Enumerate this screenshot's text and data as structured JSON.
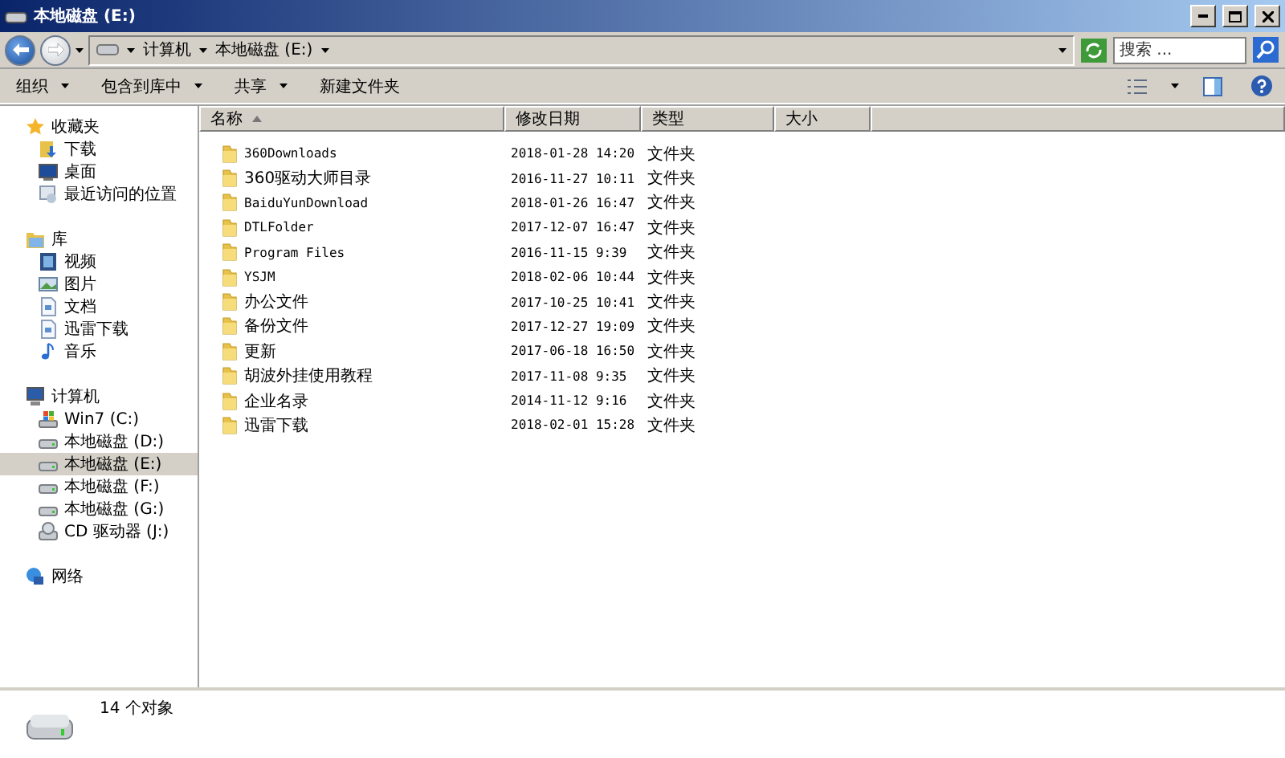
{
  "window": {
    "title": "本地磁盘 (E:)"
  },
  "address": {
    "crumbs": [
      "计算机",
      "本地磁盘 (E:)"
    ]
  },
  "search": {
    "placeholder": "搜索 ..."
  },
  "toolbar": [
    {
      "label": "组织",
      "dropdown": true
    },
    {
      "label": "包含到库中",
      "dropdown": true
    },
    {
      "label": "共享",
      "dropdown": true
    },
    {
      "label": "新建文件夹",
      "dropdown": false
    }
  ],
  "sidebar": {
    "groups": [
      {
        "label": "收藏夹",
        "kind": "star",
        "children": [
          {
            "label": "下载",
            "kind": "download",
            "selected": false
          },
          {
            "label": "桌面",
            "kind": "desktop",
            "selected": false
          },
          {
            "label": "最近访问的位置",
            "kind": "recent",
            "selected": false
          }
        ]
      },
      {
        "label": "库",
        "kind": "library",
        "children": [
          {
            "label": "视频",
            "kind": "video",
            "selected": false
          },
          {
            "label": "图片",
            "kind": "picture",
            "selected": false
          },
          {
            "label": "文档",
            "kind": "document",
            "selected": false
          },
          {
            "label": "迅雷下载",
            "kind": "document",
            "selected": false
          },
          {
            "label": "音乐",
            "kind": "music",
            "selected": false
          }
        ]
      },
      {
        "label": "计算机",
        "kind": "computer",
        "children": [
          {
            "label": "Win7 (C:)",
            "kind": "system",
            "selected": false
          },
          {
            "label": "本地磁盘 (D:)",
            "kind": "drive",
            "selected": false
          },
          {
            "label": "本地磁盘 (E:)",
            "kind": "drive",
            "selected": true
          },
          {
            "label": "本地磁盘 (F:)",
            "kind": "drive",
            "selected": false
          },
          {
            "label": "本地磁盘 (G:)",
            "kind": "drive",
            "selected": false
          },
          {
            "label": "CD 驱动器 (J:)",
            "kind": "cd",
            "selected": false
          }
        ]
      },
      {
        "label": "网络",
        "kind": "network"
      }
    ]
  },
  "table": {
    "columns": [
      {
        "label": "名称",
        "sorted": true
      },
      {
        "label": "修改日期",
        "sorted": false
      },
      {
        "label": "类型",
        "sorted": false
      },
      {
        "label": "大小",
        "sorted": false
      }
    ],
    "rows": [
      {
        "name": "360Downloads",
        "date": "2018-01-28 14:20",
        "type": "文件夹"
      },
      {
        "name": "360驱动大师目录",
        "date": "2016-11-27 10:11",
        "type": "文件夹"
      },
      {
        "name": "BaiduYunDownload",
        "date": "2018-01-26 16:47",
        "type": "文件夹"
      },
      {
        "name": "DTLFolder",
        "date": "2017-12-07 16:47",
        "type": "文件夹"
      },
      {
        "name": "Program Files",
        "date": "2016-11-15 9:39",
        "type": "文件夹"
      },
      {
        "name": "YSJM",
        "date": "2018-02-06 10:44",
        "type": "文件夹"
      },
      {
        "name": "办公文件",
        "date": "2017-10-25 10:41",
        "type": "文件夹"
      },
      {
        "name": "备份文件",
        "date": "2017-12-27 19:09",
        "type": "文件夹"
      },
      {
        "name": "更新",
        "date": "2017-06-18 16:50",
        "type": "文件夹"
      },
      {
        "name": "胡波外挂使用教程",
        "date": "2017-11-08 9:35",
        "type": "文件夹"
      },
      {
        "name": "企业名录",
        "date": "2014-11-12 9:16",
        "type": "文件夹"
      },
      {
        "name": "迅雷下载",
        "date": "2018-02-01 15:28",
        "type": "文件夹"
      }
    ]
  },
  "details": {
    "count": "14 个对象"
  }
}
